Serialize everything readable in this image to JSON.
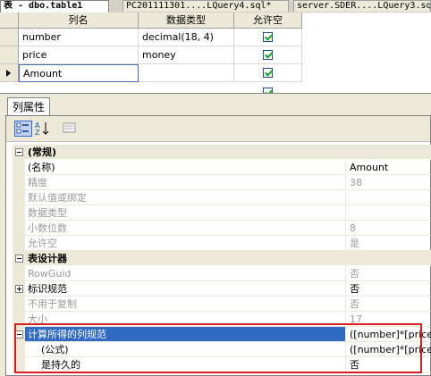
{
  "tabs": [
    {
      "label": "表 - dbo.table1"
    },
    {
      "label": "PC201111301....LQuery4.sql*"
    },
    {
      "label": "server.SDER....LQuery3.sql"
    }
  ],
  "grid": {
    "headers": [
      "列名",
      "数据类型",
      "允许空"
    ],
    "rows": [
      {
        "name": "number",
        "type": "decimal(18, 4)",
        "nullable": true
      },
      {
        "name": "price",
        "type": "money",
        "nullable": true
      },
      {
        "name": "Amount",
        "type": "",
        "nullable": true
      }
    ]
  },
  "properties_tab": {
    "label": "列属性"
  },
  "toolbar": {
    "icons": [
      "categorized-icon",
      "sort-az-icon",
      "property-pages-icon"
    ]
  },
  "properties": {
    "general": {
      "title": "(常规)",
      "items": [
        {
          "name": "(名称)",
          "value": "Amount",
          "disabled": false
        },
        {
          "name": "精度",
          "value": "38",
          "disabled": true
        },
        {
          "name": "默认值或绑定",
          "value": "",
          "disabled": true
        },
        {
          "name": "数据类型",
          "value": "",
          "disabled": true
        },
        {
          "name": "小数位数",
          "value": "8",
          "disabled": true
        },
        {
          "name": "允许空",
          "value": "是",
          "disabled": true
        }
      ]
    },
    "designer": {
      "title": "表设计器",
      "items": [
        {
          "name": "RowGuid",
          "value": "否",
          "disabled": true
        },
        {
          "name": "标识规范",
          "value": "否",
          "disabled": false
        },
        {
          "name": "不用于复制",
          "value": "否",
          "disabled": true
        },
        {
          "name": "大小",
          "value": "17",
          "disabled": true
        },
        {
          "name": "计算所得的列规范",
          "value": "([number]*[price])",
          "disabled": false
        },
        {
          "name": "(公式)",
          "value": "([number]*[price])",
          "disabled": false
        },
        {
          "name": "是持久的",
          "value": "否",
          "disabled": false
        }
      ]
    }
  },
  "colors": {
    "selection": "#316ac5",
    "highlight_box": "#d81e1e",
    "check": "#21a121"
  }
}
